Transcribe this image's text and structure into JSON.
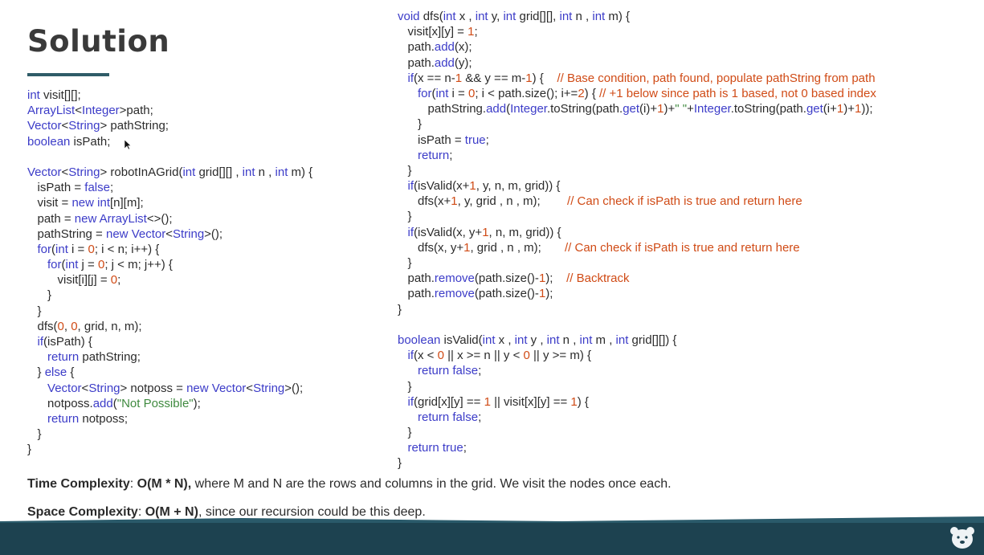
{
  "title": "Solution",
  "code_left": [
    [
      {
        "t": "int",
        "c": "kw"
      },
      {
        "t": " visit[][];"
      }
    ],
    [
      {
        "t": "ArrayList",
        "c": "kw"
      },
      {
        "t": "<"
      },
      {
        "t": "Integer",
        "c": "kw"
      },
      {
        "t": ">path;"
      }
    ],
    [
      {
        "t": "Vector",
        "c": "kw"
      },
      {
        "t": "<"
      },
      {
        "t": "String",
        "c": "kw"
      },
      {
        "t": "> pathString;"
      }
    ],
    [
      {
        "t": "boolean",
        "c": "kw"
      },
      {
        "t": " isPath;"
      }
    ],
    [
      {
        "t": ""
      }
    ],
    [
      {
        "t": "Vector",
        "c": "kw"
      },
      {
        "t": "<"
      },
      {
        "t": "String",
        "c": "kw"
      },
      {
        "t": "> robotInAGrid("
      },
      {
        "t": "int",
        "c": "kw"
      },
      {
        "t": " grid[][] , "
      },
      {
        "t": "int",
        "c": "kw"
      },
      {
        "t": " n , "
      },
      {
        "t": "int",
        "c": "kw"
      },
      {
        "t": " m) {"
      }
    ],
    [
      {
        "t": "   isPath = "
      },
      {
        "t": "false",
        "c": "kw"
      },
      {
        "t": ";"
      }
    ],
    [
      {
        "t": "   visit = "
      },
      {
        "t": "new",
        "c": "kw"
      },
      {
        "t": " "
      },
      {
        "t": "int",
        "c": "kw"
      },
      {
        "t": "[n][m];"
      }
    ],
    [
      {
        "t": "   path = "
      },
      {
        "t": "new",
        "c": "kw"
      },
      {
        "t": " "
      },
      {
        "t": "ArrayList",
        "c": "kw"
      },
      {
        "t": "<>();"
      }
    ],
    [
      {
        "t": "   pathString = "
      },
      {
        "t": "new",
        "c": "kw"
      },
      {
        "t": " "
      },
      {
        "t": "Vector",
        "c": "kw"
      },
      {
        "t": "<"
      },
      {
        "t": "String",
        "c": "kw"
      },
      {
        "t": ">();"
      }
    ],
    [
      {
        "t": "   "
      },
      {
        "t": "for",
        "c": "kw"
      },
      {
        "t": "("
      },
      {
        "t": "int",
        "c": "kw"
      },
      {
        "t": " i = "
      },
      {
        "t": "0",
        "c": "num"
      },
      {
        "t": "; i < n; i++) {"
      }
    ],
    [
      {
        "t": "      "
      },
      {
        "t": "for",
        "c": "kw"
      },
      {
        "t": "("
      },
      {
        "t": "int",
        "c": "kw"
      },
      {
        "t": " j = "
      },
      {
        "t": "0",
        "c": "num"
      },
      {
        "t": "; j < m; j++) {"
      }
    ],
    [
      {
        "t": "         visit[i][j] = "
      },
      {
        "t": "0",
        "c": "num"
      },
      {
        "t": ";"
      }
    ],
    [
      {
        "t": "      }"
      }
    ],
    [
      {
        "t": "   }"
      }
    ],
    [
      {
        "t": "   dfs("
      },
      {
        "t": "0",
        "c": "num"
      },
      {
        "t": ", "
      },
      {
        "t": "0",
        "c": "num"
      },
      {
        "t": ", grid, n, m);"
      }
    ],
    [
      {
        "t": "   "
      },
      {
        "t": "if",
        "c": "kw"
      },
      {
        "t": "(isPath) {"
      }
    ],
    [
      {
        "t": "      "
      },
      {
        "t": "return",
        "c": "kw"
      },
      {
        "t": " pathString;"
      }
    ],
    [
      {
        "t": "   } "
      },
      {
        "t": "else",
        "c": "kw"
      },
      {
        "t": " {"
      }
    ],
    [
      {
        "t": "      "
      },
      {
        "t": "Vector",
        "c": "kw"
      },
      {
        "t": "<"
      },
      {
        "t": "String",
        "c": "kw"
      },
      {
        "t": "> notposs = "
      },
      {
        "t": "new",
        "c": "kw"
      },
      {
        "t": " "
      },
      {
        "t": "Vector",
        "c": "kw"
      },
      {
        "t": "<"
      },
      {
        "t": "String",
        "c": "kw"
      },
      {
        "t": ">();"
      }
    ],
    [
      {
        "t": "      notposs."
      },
      {
        "t": "add",
        "c": "kw"
      },
      {
        "t": "("
      },
      {
        "t": "\"Not Possible\"",
        "c": "str"
      },
      {
        "t": ");"
      }
    ],
    [
      {
        "t": "      "
      },
      {
        "t": "return",
        "c": "kw"
      },
      {
        "t": " notposs;"
      }
    ],
    [
      {
        "t": "   }"
      }
    ],
    [
      {
        "t": "}"
      }
    ]
  ],
  "code_right": [
    [
      {
        "t": "void",
        "c": "kw"
      },
      {
        "t": " dfs("
      },
      {
        "t": "int",
        "c": "kw"
      },
      {
        "t": " x , "
      },
      {
        "t": "int",
        "c": "kw"
      },
      {
        "t": " y, "
      },
      {
        "t": "int",
        "c": "kw"
      },
      {
        "t": " grid[][], "
      },
      {
        "t": "int",
        "c": "kw"
      },
      {
        "t": " n , "
      },
      {
        "t": "int",
        "c": "kw"
      },
      {
        "t": " m) {"
      }
    ],
    [
      {
        "t": "   visit[x][y] = "
      },
      {
        "t": "1",
        "c": "num"
      },
      {
        "t": ";"
      }
    ],
    [
      {
        "t": "   path."
      },
      {
        "t": "add",
        "c": "kw"
      },
      {
        "t": "(x);"
      }
    ],
    [
      {
        "t": "   path."
      },
      {
        "t": "add",
        "c": "kw"
      },
      {
        "t": "(y);"
      }
    ],
    [
      {
        "t": "   "
      },
      {
        "t": "if",
        "c": "kw"
      },
      {
        "t": "(x == n-"
      },
      {
        "t": "1",
        "c": "num"
      },
      {
        "t": " && y == m-"
      },
      {
        "t": "1",
        "c": "num"
      },
      {
        "t": ") {    "
      },
      {
        "t": "// Base condition, path found, populate pathString from path",
        "c": "cmt"
      }
    ],
    [
      {
        "t": "      "
      },
      {
        "t": "for",
        "c": "kw"
      },
      {
        "t": "("
      },
      {
        "t": "int",
        "c": "kw"
      },
      {
        "t": " i = "
      },
      {
        "t": "0",
        "c": "num"
      },
      {
        "t": "; i < path.size(); i+="
      },
      {
        "t": "2",
        "c": "num"
      },
      {
        "t": ") { "
      },
      {
        "t": "// +1 below since path is 1 based, not 0 based index",
        "c": "cmt"
      }
    ],
    [
      {
        "t": "         pathString."
      },
      {
        "t": "add",
        "c": "kw"
      },
      {
        "t": "("
      },
      {
        "t": "Integer",
        "c": "kw"
      },
      {
        "t": ".toString(path."
      },
      {
        "t": "get",
        "c": "kw"
      },
      {
        "t": "(i)+"
      },
      {
        "t": "1",
        "c": "num"
      },
      {
        "t": ")+"
      },
      {
        "t": "\" \"",
        "c": "str"
      },
      {
        "t": "+"
      },
      {
        "t": "Integer",
        "c": "kw"
      },
      {
        "t": ".toString(path."
      },
      {
        "t": "get",
        "c": "kw"
      },
      {
        "t": "(i+"
      },
      {
        "t": "1",
        "c": "num"
      },
      {
        "t": ")+"
      },
      {
        "t": "1",
        "c": "num"
      },
      {
        "t": "));"
      }
    ],
    [
      {
        "t": "      }"
      }
    ],
    [
      {
        "t": "      isPath = "
      },
      {
        "t": "true",
        "c": "kw"
      },
      {
        "t": ";"
      }
    ],
    [
      {
        "t": "      "
      },
      {
        "t": "return",
        "c": "kw"
      },
      {
        "t": ";"
      }
    ],
    [
      {
        "t": "   }"
      }
    ],
    [
      {
        "t": "   "
      },
      {
        "t": "if",
        "c": "kw"
      },
      {
        "t": "(isValid(x+"
      },
      {
        "t": "1",
        "c": "num"
      },
      {
        "t": ", y, n, m, grid)) {"
      }
    ],
    [
      {
        "t": "      dfs(x+"
      },
      {
        "t": "1",
        "c": "num"
      },
      {
        "t": ", y, grid , n , m);        "
      },
      {
        "t": "// Can check if isPath is true and return here",
        "c": "cmt"
      }
    ],
    [
      {
        "t": "   }"
      }
    ],
    [
      {
        "t": "   "
      },
      {
        "t": "if",
        "c": "kw"
      },
      {
        "t": "(isValid(x, y+"
      },
      {
        "t": "1",
        "c": "num"
      },
      {
        "t": ", n, m, grid)) {"
      }
    ],
    [
      {
        "t": "      dfs(x, y+"
      },
      {
        "t": "1",
        "c": "num"
      },
      {
        "t": ", grid , n , m);       "
      },
      {
        "t": "// Can check if isPath is true and return here",
        "c": "cmt"
      }
    ],
    [
      {
        "t": "   }"
      }
    ],
    [
      {
        "t": "   path."
      },
      {
        "t": "remove",
        "c": "kw"
      },
      {
        "t": "(path.size()-"
      },
      {
        "t": "1",
        "c": "num"
      },
      {
        "t": ");    "
      },
      {
        "t": "// Backtrack",
        "c": "cmt"
      }
    ],
    [
      {
        "t": "   path."
      },
      {
        "t": "remove",
        "c": "kw"
      },
      {
        "t": "(path.size()-"
      },
      {
        "t": "1",
        "c": "num"
      },
      {
        "t": ");"
      }
    ],
    [
      {
        "t": "}"
      }
    ],
    [
      {
        "t": ""
      }
    ],
    [
      {
        "t": "boolean",
        "c": "kw"
      },
      {
        "t": " isValid("
      },
      {
        "t": "int",
        "c": "kw"
      },
      {
        "t": " x , "
      },
      {
        "t": "int",
        "c": "kw"
      },
      {
        "t": " y , "
      },
      {
        "t": "int",
        "c": "kw"
      },
      {
        "t": " n , "
      },
      {
        "t": "int",
        "c": "kw"
      },
      {
        "t": " m , "
      },
      {
        "t": "int",
        "c": "kw"
      },
      {
        "t": " grid[][]) {"
      }
    ],
    [
      {
        "t": "   "
      },
      {
        "t": "if",
        "c": "kw"
      },
      {
        "t": "(x < "
      },
      {
        "t": "0",
        "c": "num"
      },
      {
        "t": " || x >= n || y < "
      },
      {
        "t": "0",
        "c": "num"
      },
      {
        "t": " || y >= m) {"
      }
    ],
    [
      {
        "t": "      "
      },
      {
        "t": "return",
        "c": "kw"
      },
      {
        "t": " "
      },
      {
        "t": "false",
        "c": "kw"
      },
      {
        "t": ";"
      }
    ],
    [
      {
        "t": "   }"
      }
    ],
    [
      {
        "t": "   "
      },
      {
        "t": "if",
        "c": "kw"
      },
      {
        "t": "(grid[x][y] == "
      },
      {
        "t": "1",
        "c": "num"
      },
      {
        "t": " || visit[x][y] == "
      },
      {
        "t": "1",
        "c": "num"
      },
      {
        "t": ") {"
      }
    ],
    [
      {
        "t": "      "
      },
      {
        "t": "return",
        "c": "kw"
      },
      {
        "t": " "
      },
      {
        "t": "false",
        "c": "kw"
      },
      {
        "t": ";"
      }
    ],
    [
      {
        "t": "   }"
      }
    ],
    [
      {
        "t": "   "
      },
      {
        "t": "return",
        "c": "kw"
      },
      {
        "t": " "
      },
      {
        "t": "true",
        "c": "kw"
      },
      {
        "t": ";"
      }
    ],
    [
      {
        "t": "}"
      }
    ]
  ],
  "time_complexity": {
    "label": "Time Complexity",
    "sep": ": ",
    "value": "O(M * N),",
    "text": " where M and N are the rows and columns in the grid. We visit the nodes once each."
  },
  "space_complexity": {
    "label": "Space Complexity",
    "sep": ": ",
    "value": "O(M + N)",
    "text": ", since our recursion could be this deep."
  },
  "colors": {
    "keyword": "#3c3cc8",
    "number": "#d04b16",
    "string": "#3f8a3f",
    "comment": "#d04b16",
    "footer": "#1d4250",
    "title_underline": "#2f5c68"
  },
  "icons": {
    "mouse_cursor": "cursor-arrow-icon",
    "mascot": "bear-mascot-icon"
  }
}
